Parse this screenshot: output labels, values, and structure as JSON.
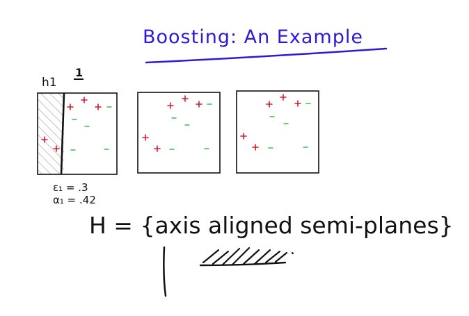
{
  "title": "Boosting: An Example",
  "colors": {
    "title_ink": "#2b1ad6",
    "plus": "#d8192c",
    "minus": "#3bbf45",
    "ink": "#111111",
    "hatch": "#a9a9a9"
  },
  "panel1": {
    "classifier_label": "h1",
    "round_label": "1"
  },
  "annotations": {
    "epsilon": "ε₁ = .3",
    "alpha": "α₁ = .42"
  },
  "hypothesis_set": "H = {axis aligned semi-planes}"
}
